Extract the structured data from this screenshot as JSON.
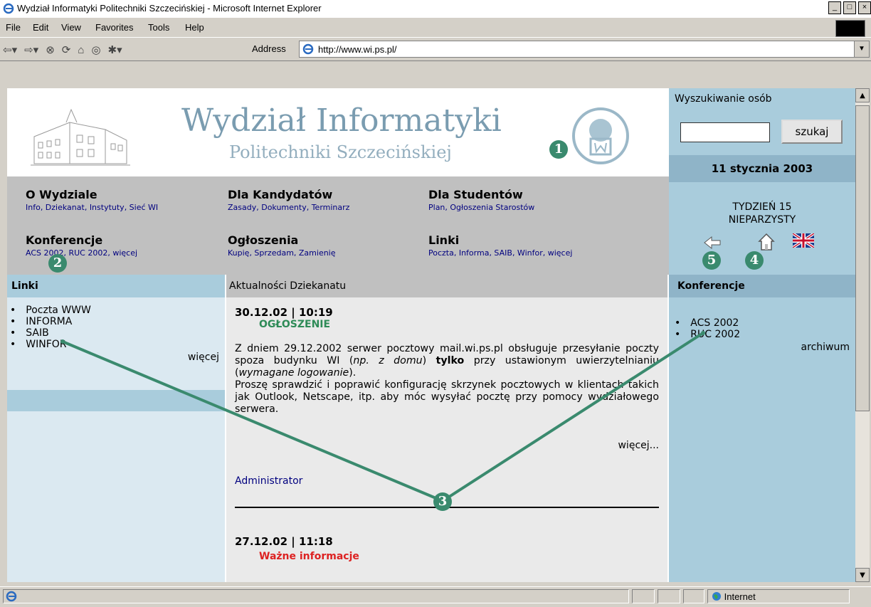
{
  "window": {
    "title": "Wydział Informatyki Politechniki Szczecińskiej - Microsoft Internet Explorer",
    "buttons": [
      "_",
      "□",
      "×"
    ]
  },
  "menu": [
    "File",
    "Edit",
    "View",
    "Favorites",
    "Tools",
    "Help"
  ],
  "address": {
    "label": "Address",
    "url": "http://www.wi.ps.pl/"
  },
  "header": {
    "title": "Wydział Informatyki",
    "subtitle": "Politechniki Szczecińskiej"
  },
  "nav": [
    {
      "heading": "O Wydziale",
      "links": "Info, Dziekanat, Instytuty, Sieć WI"
    },
    {
      "heading": "Dla Kandydatów",
      "links": "Zasady, Dokumenty, Terminarz"
    },
    {
      "heading": "Dla Studentów",
      "links": "Plan, Ogłoszenia Starostów"
    },
    {
      "heading": "Konferencje",
      "links": "ACS 2002, RUC 2002, więcej"
    },
    {
      "heading": "Ogłoszenia",
      "links": "Kupię, Sprzedam, Zamienię"
    },
    {
      "heading": "Linki",
      "links": "Poczta, Informa, SAIB, Winfor, więcej"
    }
  ],
  "search": {
    "title": "Wyszukiwanie osób",
    "button": "szukaj",
    "date": "11 stycznia 2003",
    "week_line1": "TYDZIEŃ 15",
    "week_line2": "NIEPARZYSTY"
  },
  "links_panel": {
    "heading": "Linki",
    "items": [
      "Poczta WWW",
      "INFORMA",
      "SAIB",
      "WINFOR"
    ],
    "more": "więcej"
  },
  "news_panel": {
    "heading": "Aktualności Dziekanatu",
    "item1": {
      "date": "30.12.02 | 10:19",
      "category": "OGŁOSZENIE",
      "p1_a": "Z dniem 29.12.2002 serwer pocztowy mail.wi.ps.pl obsługuje przesyłanie poczty spoza budynku WI (",
      "p1_em1": "np. z domu",
      "p1_b": ") ",
      "p1_bold": "tylko",
      "p1_c": " przy ustawionym uwierzytelnianiu (",
      "p1_em2": "wymagane logowanie",
      "p1_d": ").",
      "p2": "Proszę sprawdzić i poprawić konfigurację skrzynek pocztowych w klientach takich jak Outlook, Netscape, itp. aby móc wysyłać pocztę przy pomocy wydziałowego serwera.",
      "more": "więcej...",
      "author": "Administrator"
    },
    "item2": {
      "date": "27.12.02 | 11:18",
      "category": "Ważne informacje"
    }
  },
  "conf_panel": {
    "heading": "Konferencje",
    "items": [
      "ACS 2002",
      "RUC 2002"
    ],
    "archive": "archiwum"
  },
  "status": {
    "zone": "Internet"
  },
  "callouts": [
    "1",
    "2",
    "3",
    "4",
    "5"
  ],
  "colors": {
    "callout": "#3a8a6e",
    "panel_blue": "#a9ccdc",
    "nav_gray": "#c0c0c0"
  }
}
